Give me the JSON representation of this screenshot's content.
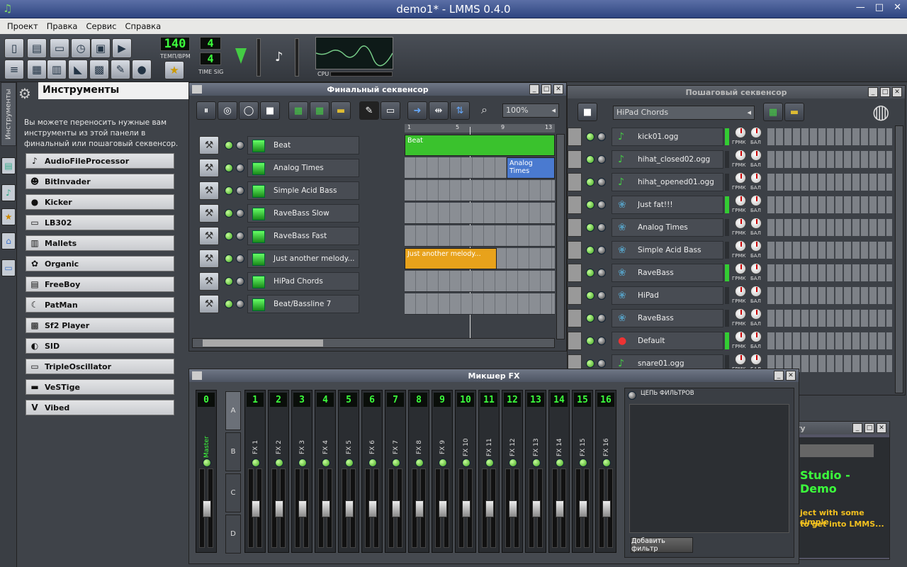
{
  "window": {
    "title": "demo1* - LMMS 0.4.0"
  },
  "menu": [
    "Проект",
    "Правка",
    "Сервис",
    "Справка"
  ],
  "toolbar": {
    "tempo": "140",
    "tempo_label": "ТЕМП/BPM",
    "timesig_num": "4",
    "timesig_den": "4",
    "timesig_label": "TIME SIG",
    "cpu_label": "CPU"
  },
  "instruments_panel": {
    "tab": "Инструменты",
    "title": "Инструменты",
    "description": "Вы можете переносить нужные вам инструменты из этой панели в финальный или пошаговый секвенсор.",
    "items": [
      "AudioFileProcessor",
      "BitInvader",
      "Kicker",
      "LB302",
      "Mallets",
      "Organic",
      "FreeBoy",
      "PatMan",
      "Sf2 Player",
      "SID",
      "TripleOscillator",
      "VeSTige",
      "Vibed"
    ]
  },
  "song_editor": {
    "title": "Финальный секвенсор",
    "zoom": "100%",
    "ruler": [
      "1",
      "5",
      "9",
      "13"
    ],
    "tracks": [
      "Beat",
      "Analog Times",
      "Simple Acid Bass",
      "RaveBass Slow",
      "RaveBass Fast",
      "Just another melody...",
      "HiPad Chords",
      "Beat/Bassline 7"
    ],
    "blocks": [
      {
        "label": "Beat"
      },
      {
        "label": "Analog Times"
      },
      {
        "label": "Just another melody..."
      }
    ]
  },
  "bb_editor": {
    "title": "Пошаговый секвенсор",
    "pattern": "HiPad Chords",
    "knob_labels": [
      "ГРМК",
      "БАЛ"
    ],
    "tracks": [
      "kick01.ogg",
      "hihat_closed02.ogg",
      "hihat_opened01.ogg",
      "Just fat!!!",
      "Analog Times",
      "Simple Acid Bass",
      "RaveBass",
      "HiPad",
      "RaveBass",
      "Default",
      "snare01.ogg"
    ]
  },
  "mixer": {
    "title": "Микшер FX",
    "master_num": "0",
    "master_label": "Master",
    "channels": [
      {
        "num": "1",
        "label": "FX 1"
      },
      {
        "num": "2",
        "label": "FX 2"
      },
      {
        "num": "3",
        "label": "FX 3"
      },
      {
        "num": "4",
        "label": "FX 4"
      },
      {
        "num": "5",
        "label": "FX 5"
      },
      {
        "num": "6",
        "label": "FX 6"
      },
      {
        "num": "7",
        "label": "FX 7"
      },
      {
        "num": "8",
        "label": "FX 8"
      },
      {
        "num": "9",
        "label": "FX 9"
      },
      {
        "num": "10",
        "label": "FX 10"
      },
      {
        "num": "11",
        "label": "FX 11"
      },
      {
        "num": "12",
        "label": "FX 12"
      },
      {
        "num": "13",
        "label": "FX 13"
      },
      {
        "num": "14",
        "label": "FX 14"
      },
      {
        "num": "15",
        "label": "FX 15"
      },
      {
        "num": "16",
        "label": "FX 16"
      }
    ],
    "banks": [
      "A",
      "B",
      "C",
      "D"
    ],
    "chain_label": "ЦЕПЬ ФИЛЬТРОВ",
    "add_filter": "Добавить фильтр"
  },
  "project_notes": {
    "title_fragment": "ту",
    "text1": "Studio - Demo",
    "text2": "ject with some simple",
    "text3": "to get into LMMS..."
  }
}
